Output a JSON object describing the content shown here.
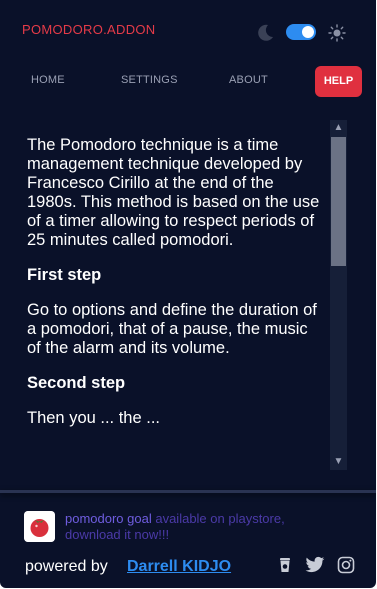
{
  "header": {
    "brand": "POMODORO.ADDON",
    "theme_toggle_on": true
  },
  "nav": {
    "home": "HOME",
    "settings": "SETTINGS",
    "about": "ABOUT",
    "help": "HELP"
  },
  "content": {
    "intro": "The Pomodoro technique is a time management technique developed by Francesco Cirillo at the end of the 1980s. This method is based on the use of a timer allowing to respect periods of 25 minutes called pomodori.",
    "step1_title": "First step",
    "step1_text": "Go to options and define the duration of a pomodori, that of a pause, the music of the alarm and its volume.",
    "step2_title": "Second step",
    "step2_text_partial": "Then you ... the ..."
  },
  "footer": {
    "promo_link": "pomodoro goal",
    "promo_rest": " available on playstore, download it now!!!",
    "powered_by": "powered by",
    "author": "Darrell KIDJO"
  },
  "colors": {
    "background": "#0a1129",
    "brand": "#e63b48",
    "help_button": "#e0303f",
    "toggle": "#2d8cf0",
    "author_link": "#2d8cf0",
    "promo_link": "#6f5de0"
  },
  "icons": [
    "moon-icon",
    "sun-icon",
    "tomato-icon",
    "coffee-icon",
    "twitter-icon",
    "instagram-icon",
    "chevron-up-icon",
    "chevron-down-icon"
  ]
}
